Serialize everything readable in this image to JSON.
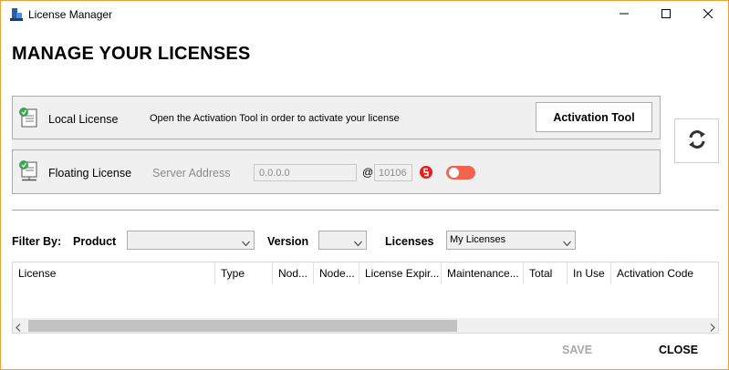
{
  "window": {
    "title": "License Manager",
    "accent_border": "#e8a13b",
    "controls": [
      "minimize-icon",
      "maximize-icon",
      "close-icon"
    ]
  },
  "page": {
    "heading": "MANAGE YOUR LICENSES"
  },
  "local_license": {
    "icon": "license-certificate-icon",
    "label": "Local License",
    "hint": "Open the Activation Tool in order to activate your license",
    "button_label": "Activation Tool"
  },
  "floating_license": {
    "icon": "license-network-icon",
    "label": "Floating License",
    "server_label": "Server Address",
    "server_value": "0.0.0.0",
    "at_sign": "@",
    "port_value": "10106",
    "status_icon": "server-status-icon",
    "status_color": "#e02020",
    "toggle_on": false,
    "toggle_color": "#f26450"
  },
  "refresh": {
    "icon": "refresh-icon"
  },
  "filter": {
    "filter_by_label": "Filter By:",
    "product_label": "Product",
    "product_value": "",
    "version_label": "Version",
    "version_value": "",
    "licenses_label": "Licenses",
    "licenses_value": "My Licenses"
  },
  "table": {
    "columns": [
      "License",
      "Type",
      "Nod...",
      "Node...",
      "License Expir...",
      "Maintenance...",
      "Total",
      "In Use",
      "Activation Code"
    ],
    "rows": []
  },
  "footer": {
    "save_label": "SAVE",
    "save_enabled": false,
    "close_label": "CLOSE"
  }
}
